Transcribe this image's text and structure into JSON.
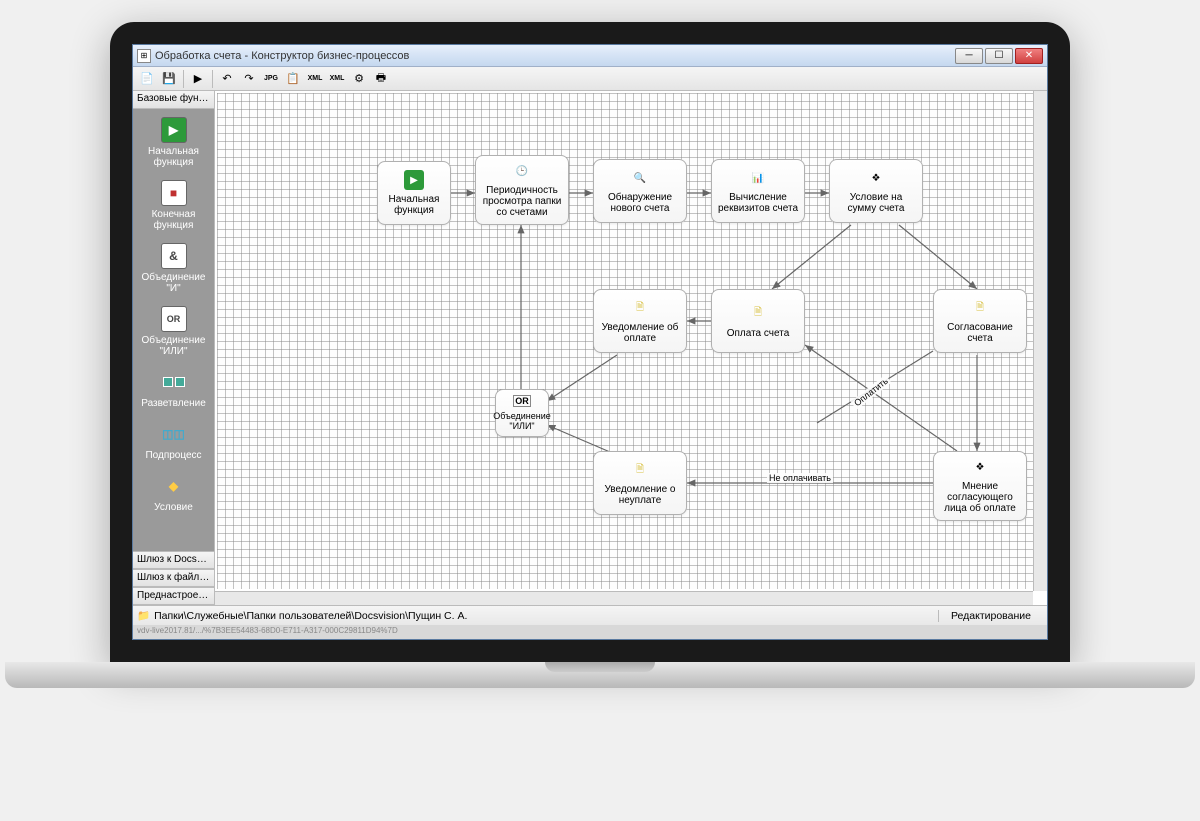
{
  "titlebar": {
    "title": "Обработка счета - Конструктор бизнес-процессов"
  },
  "sidebar": {
    "header": "Базовые функц...",
    "items": [
      {
        "label": "Начальная функция",
        "icon": "play",
        "color": "#2d9a3a"
      },
      {
        "label": "Конечная функция",
        "icon": "stop",
        "color": "#c03030"
      },
      {
        "label": "Объединение \"И\"",
        "icon": "and",
        "text": "&"
      },
      {
        "label": "Объединение \"ИЛИ\"",
        "icon": "or",
        "text": "OR"
      },
      {
        "label": "Разветвление",
        "icon": "split"
      },
      {
        "label": "Подпроцесс",
        "icon": "subproc"
      },
      {
        "label": "Условие",
        "icon": "cond"
      }
    ],
    "footer": [
      "Шлюз к Docsvis...",
      "Шлюз к файлов ...",
      "Преднастроенн..."
    ]
  },
  "nodes": {
    "start": "Начальная функция",
    "period": "Периодичность просмотра папки со счетами",
    "detect": "Обнаружение нового счета",
    "calc": "Вычисление реквизитов счета",
    "cond_sum": "Условие на сумму счета",
    "notify_pay": "Уведомление об оплате",
    "pay": "Оплата счета",
    "approve": "Согласование счета",
    "or_join": "Объединение \"ИЛИ\"",
    "notify_nopay": "Уведомление о неуплате",
    "opinion": "Мнение согласующего лица об оплате"
  },
  "edge_labels": {
    "pay_edge": "Оплатить",
    "nopay_edge": "Не оплачивать"
  },
  "statusbar": {
    "path": "Папки\\Служебные\\Папки пользователей\\Docsvision\\Пущин С. А.",
    "mode": "Редактирование"
  },
  "url": "vdv-live2017.81/.../%7B3EE54483-68D0-E711-A317-000C29811D94%7D"
}
